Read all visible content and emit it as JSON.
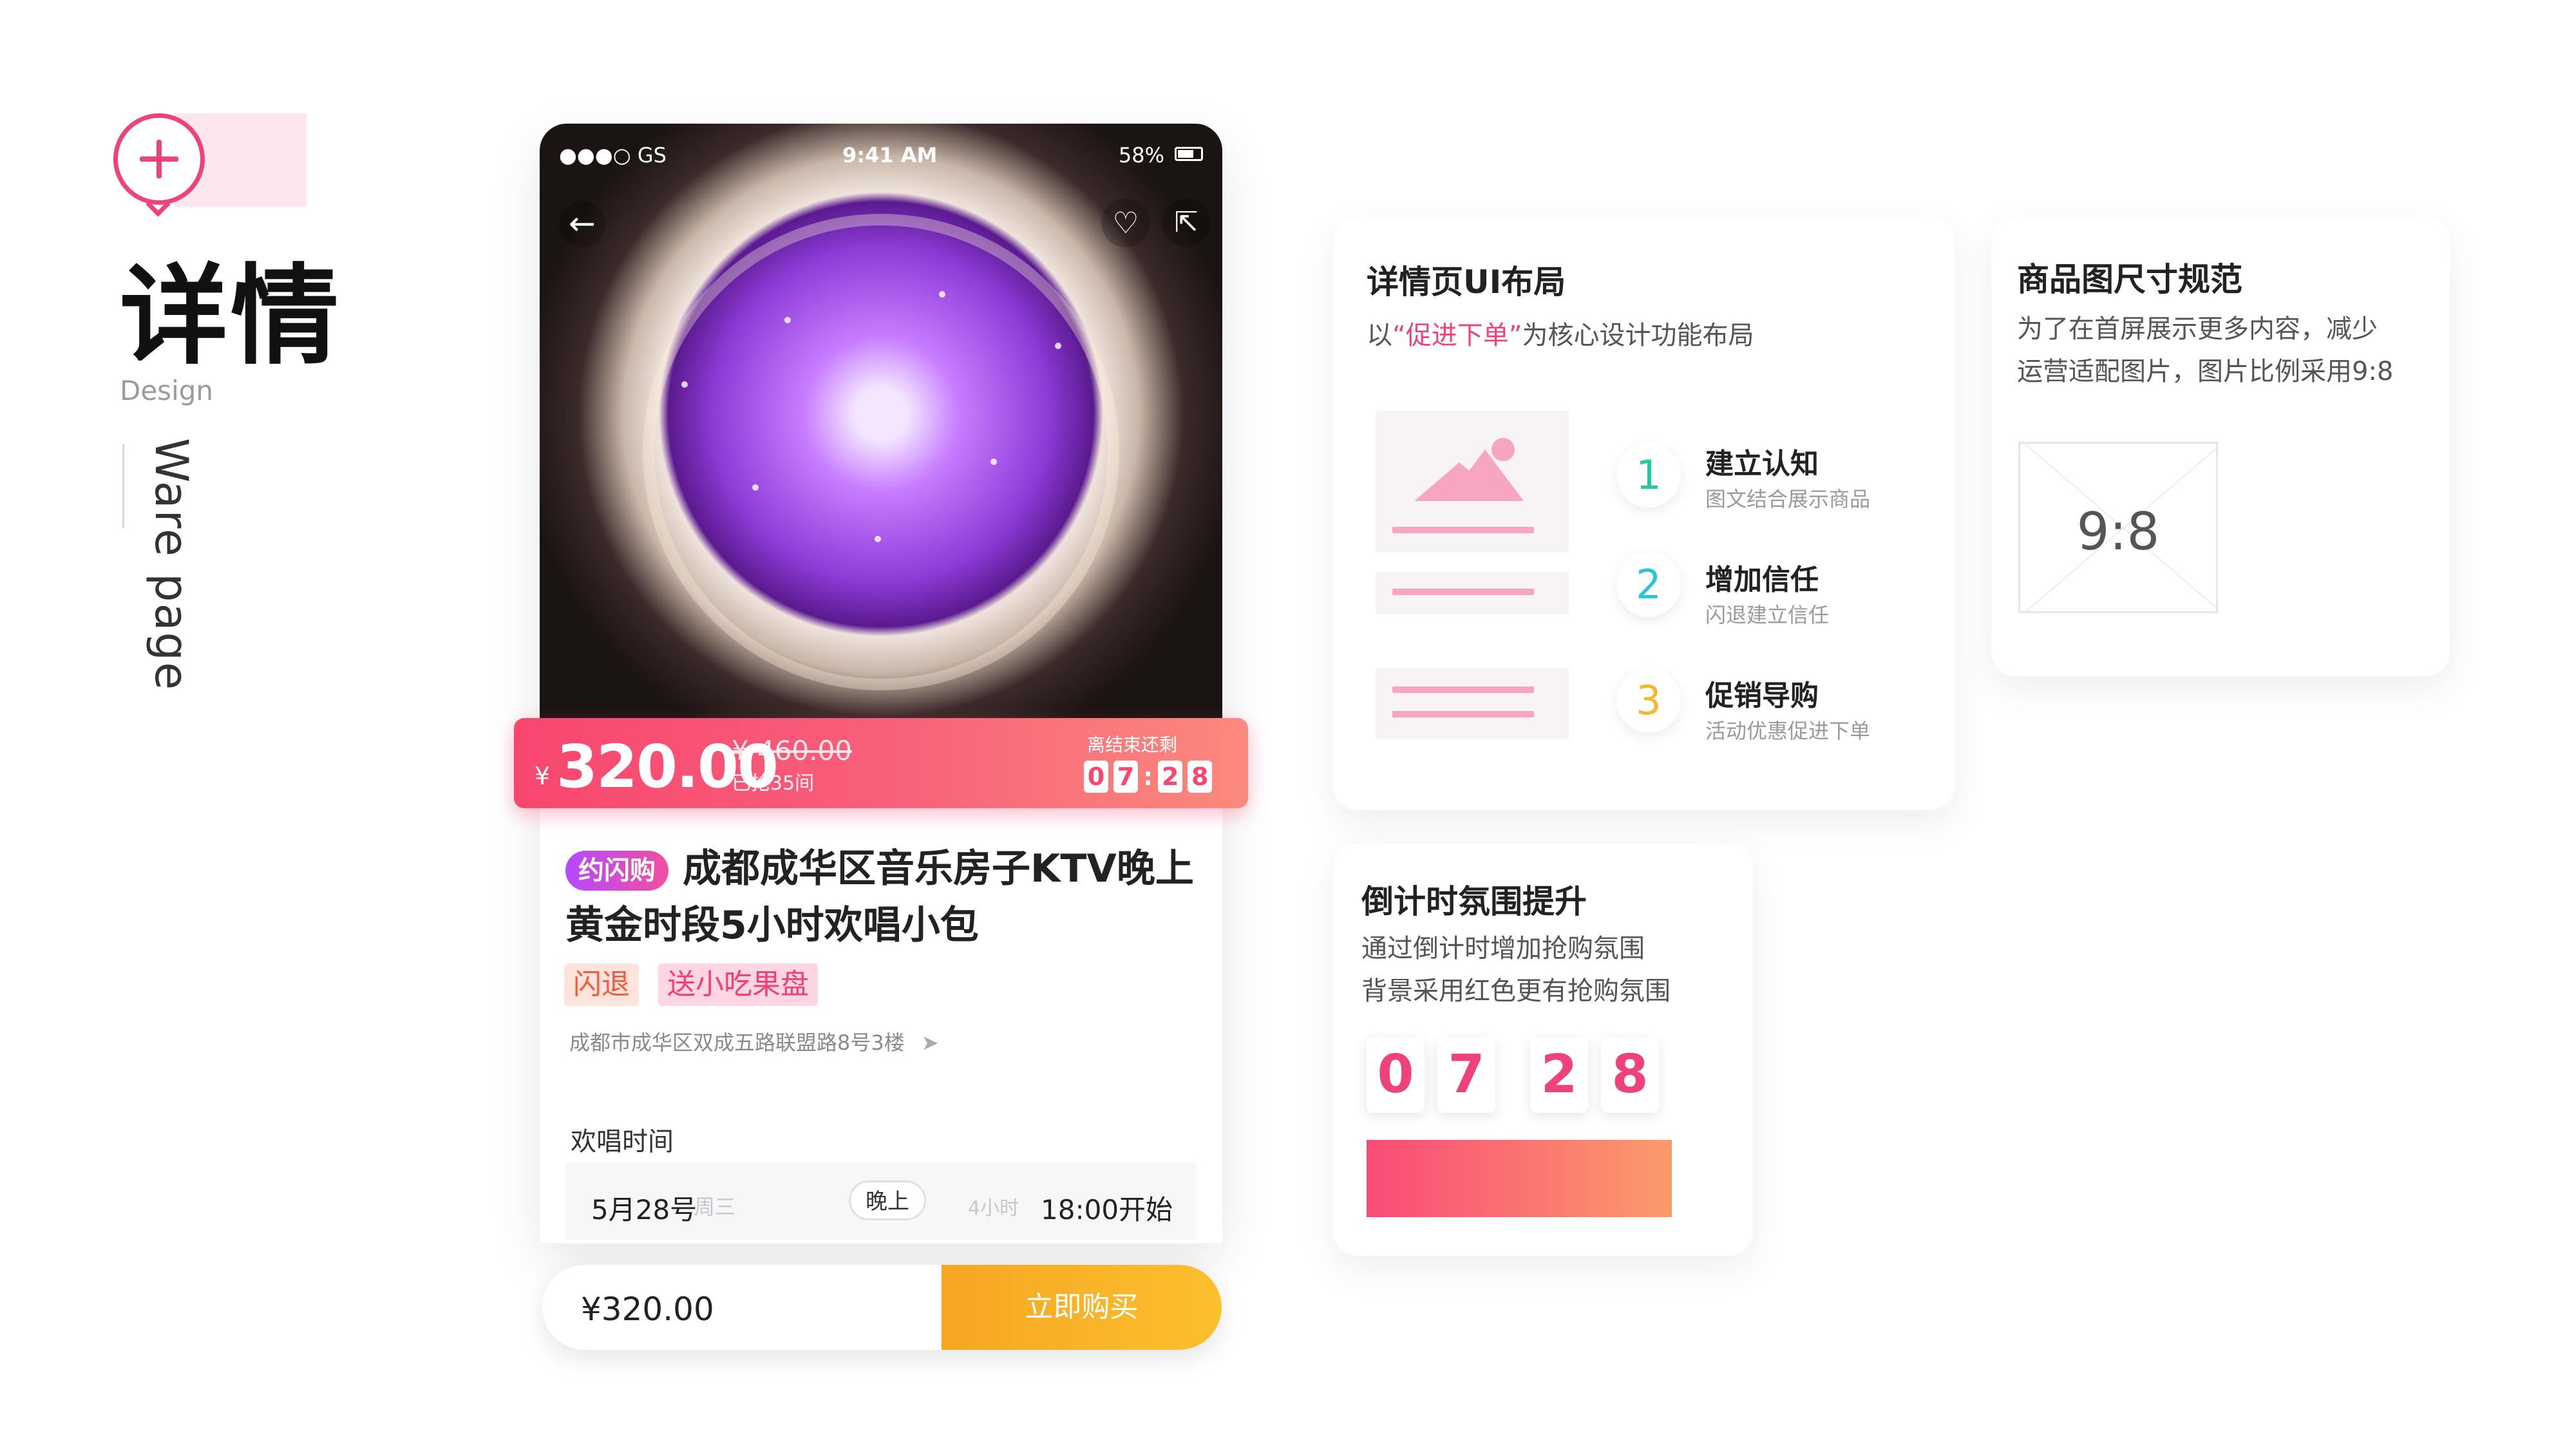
{
  "header": {
    "title_cn": "详情",
    "subtitle_en": "Design",
    "vertical_text": "Ware page",
    "plus_icon": "plus-circle-icon",
    "accent_color": "#f0427a"
  },
  "phone": {
    "status": {
      "carrier": "●●●○ GS",
      "time": "9:41 AM",
      "battery": "58%"
    },
    "nav": {
      "back_icon": "←",
      "heart_icon": "♡",
      "share_icon": "⇱"
    },
    "price": {
      "currency": "¥",
      "current": "320.00",
      "original": "¥ 460.00",
      "sold": "已抢35间",
      "ends_label": "离结束还剩",
      "timer": [
        "0",
        "7",
        "2",
        "8"
      ]
    },
    "product": {
      "badge": "约闪购",
      "title": "成都成华区音乐房子KTV晚上黄金时段5小时欢唱小包",
      "tags": [
        "闪退",
        "送小吃果盘"
      ],
      "address": "成都市成华区双成五路联盟路8号3楼"
    },
    "schedule": {
      "label": "欢唱时间",
      "date": "5月28号",
      "weekday": "周三",
      "period": "晚上",
      "duration": "4小时",
      "start": "18:00开始"
    },
    "bottom": {
      "price": "¥320.00",
      "buy": "立即购买"
    }
  },
  "card_layout": {
    "title": "详情页UI布局",
    "desc_pre": "以",
    "desc_highlight": "“促进下单”",
    "desc_post": "为核心设计功能布局",
    "steps": [
      {
        "num": "1",
        "title": "建立认知",
        "sub": "图文结合展示商品",
        "color": "#27c7a4"
      },
      {
        "num": "2",
        "title": "增加信任",
        "sub": "闪退建立信任",
        "color": "#2ac3d8"
      },
      {
        "num": "3",
        "title": "促销导购",
        "sub": "活动优惠促进下单",
        "color": "#f5b82e"
      }
    ]
  },
  "card_ratio": {
    "title": "商品图尺寸规范",
    "desc_line1": "为了在首屏展示更多内容，减少",
    "desc_line2": "运营适配图片，图片比例采用9:8",
    "ratio_label": "9:8"
  },
  "card_countdown": {
    "title": "倒计时氛围提升",
    "desc_line1": "通过倒计时增加抢购氛围",
    "desc_line2": "背景采用红色更有抢购氛围",
    "digits": [
      "0",
      "7",
      "2",
      "8"
    ]
  }
}
